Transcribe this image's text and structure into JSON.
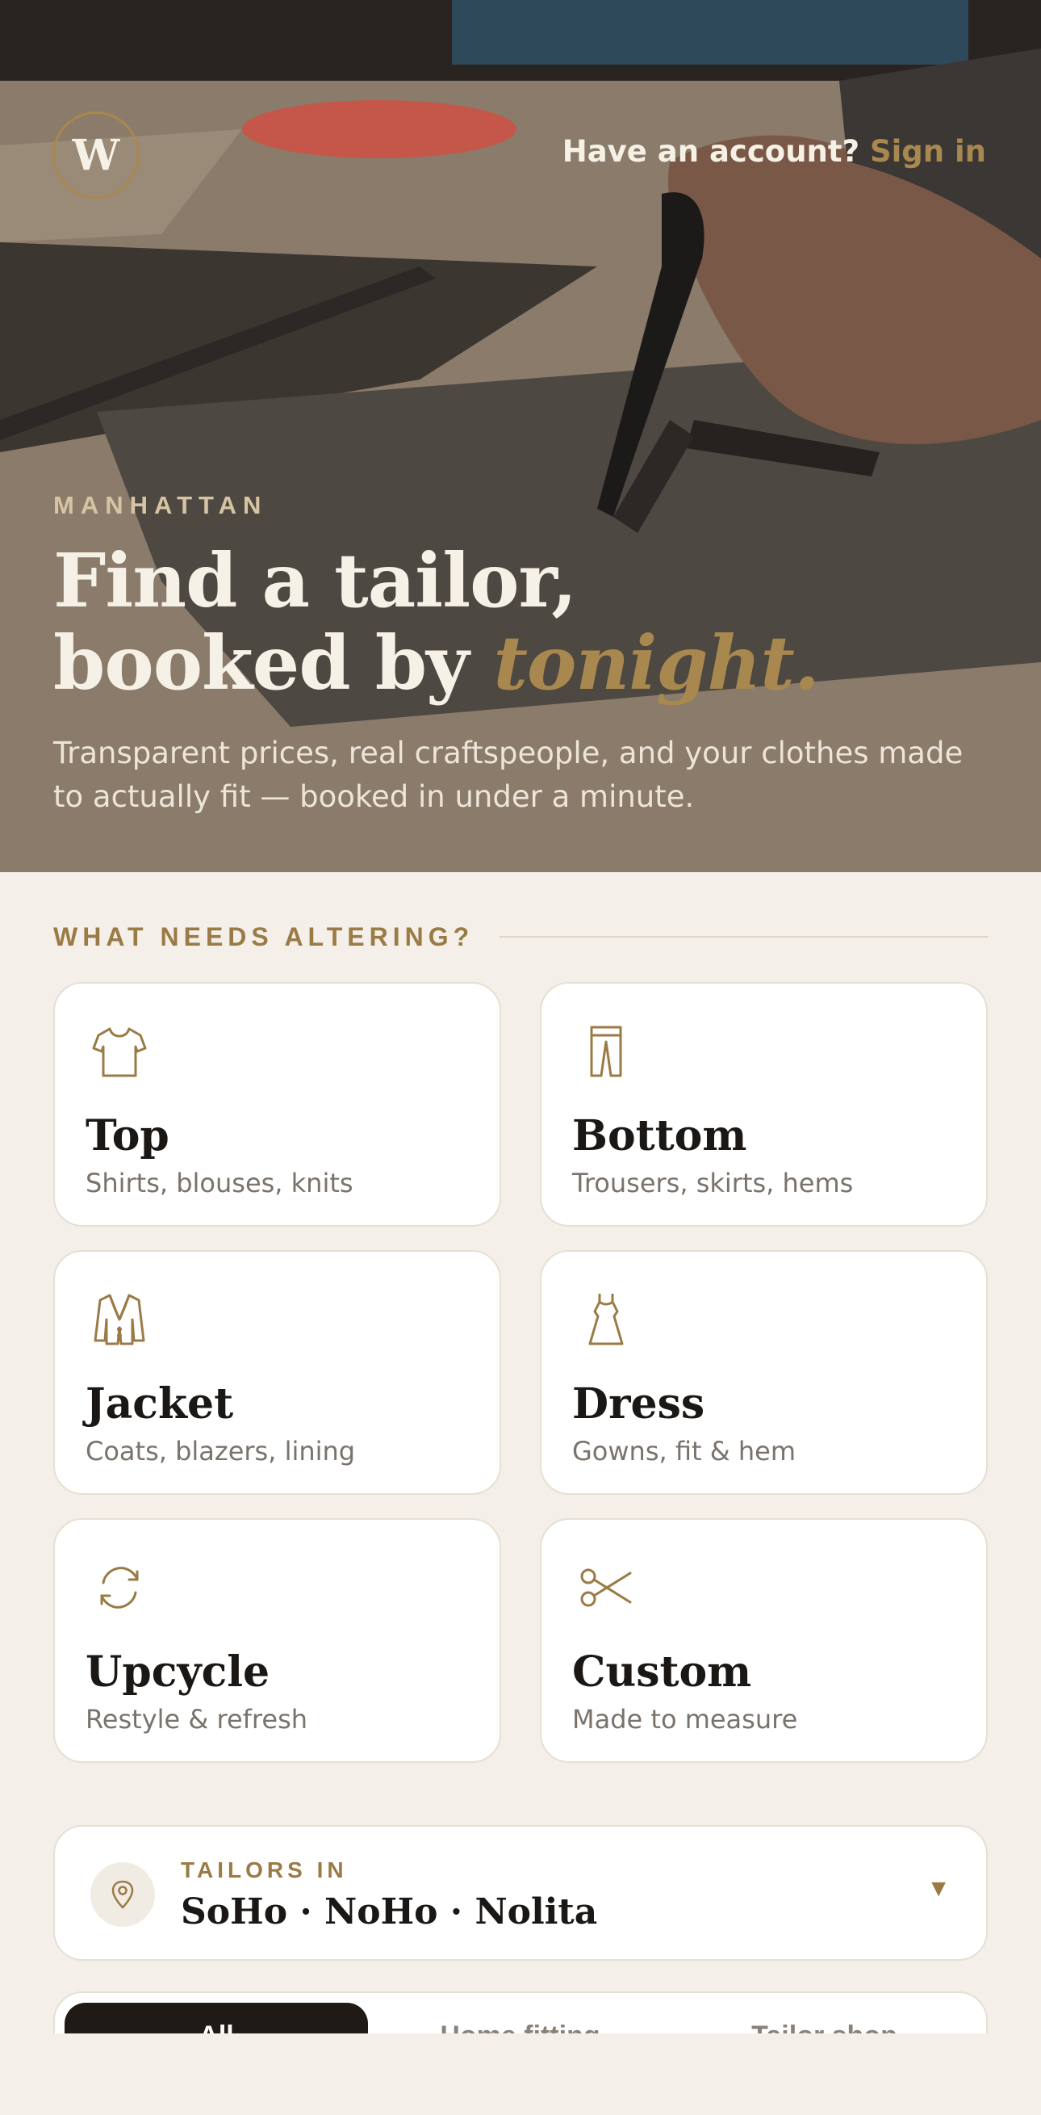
{
  "hero": {
    "logo_letter": "W",
    "account_prompt": "Have an account?",
    "signin_label": "Sign in",
    "eyebrow": "MANHATTAN",
    "headline_line1": "Find a tailor,",
    "headline_line2": "booked by",
    "headline_accent": "tonight.",
    "subtitle": "Transparent prices, real craftspeople, and your clothes made to actually fit — booked in under a minute."
  },
  "section": {
    "label": "WHAT NEEDS ALTERING?"
  },
  "categories": [
    {
      "title": "Top",
      "desc": "Shirts, blouses, knits",
      "icon": "shirt-icon"
    },
    {
      "title": "Bottom",
      "desc": "Trousers, skirts, hems",
      "icon": "trousers-icon"
    },
    {
      "title": "Jacket",
      "desc": "Coats, blazers, lining",
      "icon": "jacket-icon"
    },
    {
      "title": "Dress",
      "desc": "Gowns, fit & hem",
      "icon": "dress-icon"
    },
    {
      "title": "Upcycle",
      "desc": "Restyle & refresh",
      "icon": "refresh-icon"
    },
    {
      "title": "Custom",
      "desc": "Made to measure",
      "icon": "scissors-icon"
    }
  ],
  "location": {
    "prefix": "TAILORS IN",
    "value": "SoHo · NoHo · Nolita",
    "caret": "▼"
  },
  "tabs": [
    {
      "label": "All",
      "active": true
    },
    {
      "label": "Home fitting",
      "active": false
    },
    {
      "label": "Tailor shop",
      "active": false
    }
  ],
  "colors": {
    "accent": "#a8884f",
    "background": "#f4f0e9",
    "card": "#ffffff",
    "dark": "#1f1a16"
  }
}
